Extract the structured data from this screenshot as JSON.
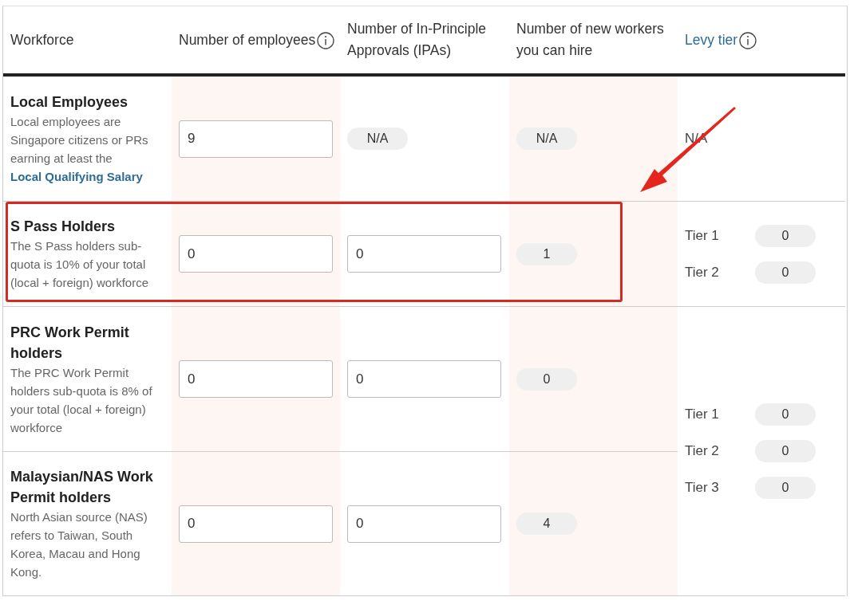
{
  "columns": [
    {
      "label": "Workforce",
      "info": false,
      "link": false
    },
    {
      "label": "Number of employees",
      "info": true,
      "link": false
    },
    {
      "label": "Number of In-Principle Approvals (IPAs)",
      "info": false,
      "link": false
    },
    {
      "label": "Number of new workers you can hire",
      "info": false,
      "link": false
    },
    {
      "label": "Levy tier",
      "info": true,
      "link": true
    }
  ],
  "rows": [
    {
      "title": "Local Employees",
      "highlighted": false,
      "description": "Local employees are Singapore citizens or PRs earning at least the",
      "description_link": "Local Qualifying Salary",
      "employees": {
        "kind": "input",
        "value": "9"
      },
      "ipas": {
        "kind": "pill",
        "value": "N/A"
      },
      "new_workers": "N/A",
      "levy": {
        "kind": "text",
        "text": "N/A"
      }
    },
    {
      "title": "S Pass Holders",
      "highlighted": true,
      "description": "The S Pass holders sub-quota is 10% of your total (local + foreign) workforce",
      "employees": {
        "kind": "input",
        "value": "0"
      },
      "ipas": {
        "kind": "input",
        "value": "0"
      },
      "new_workers": "1",
      "levy": {
        "kind": "tiers",
        "tiers": [
          {
            "label": "Tier 1",
            "value": "0"
          },
          {
            "label": "Tier 2",
            "value": "0"
          }
        ]
      }
    },
    {
      "title": "PRC Work Permit holders",
      "highlighted": false,
      "description": "The PRC Work Permit holders sub-quota is 8% of your total (local + foreign) workforce",
      "employees": {
        "kind": "input",
        "value": "0"
      },
      "ipas": {
        "kind": "input",
        "value": "0"
      },
      "new_workers": "0",
      "levy": {
        "kind": "tiers",
        "tiers": [
          {
            "label": "Tier 1",
            "value": "0"
          },
          {
            "label": "Tier 2",
            "value": "0"
          },
          {
            "label": "Tier 3",
            "value": "0"
          }
        ]
      }
    },
    {
      "title": "Malaysian/NAS Work Permit holders",
      "highlighted": false,
      "description": "North Asian source (NAS) refers to Taiwan, South Korea, Macau and Hong Kong.",
      "employees": {
        "kind": "input",
        "value": "0"
      },
      "ipas": {
        "kind": "input",
        "value": "0"
      },
      "new_workers": "4"
    }
  ]
}
